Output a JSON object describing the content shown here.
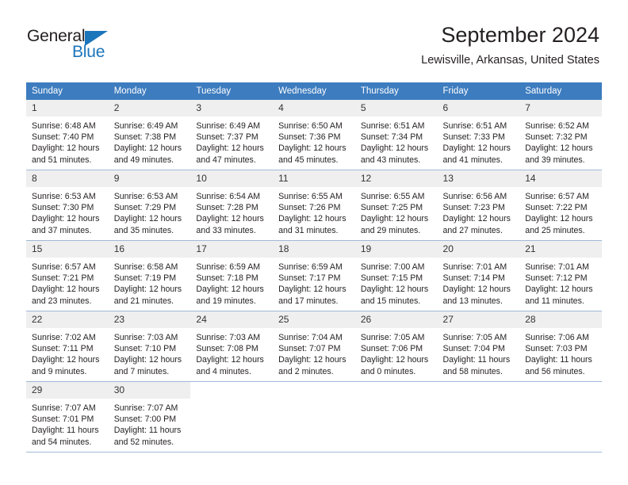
{
  "logo": {
    "word_top": "General",
    "word_bottom": "Blue",
    "triangle_color": "#1b75bb",
    "text_color": "#231f20"
  },
  "header": {
    "title": "September 2024",
    "subtitle": "Lewisville, Arkansas, United States"
  },
  "theme": {
    "header_row_bg": "#3d7cbf",
    "header_row_text": "#ffffff",
    "day_number_bg": "#efefef",
    "grid_line": "#9fb9d6",
    "body_text": "#231f20"
  },
  "calendar": {
    "weekdays": [
      "Sunday",
      "Monday",
      "Tuesday",
      "Wednesday",
      "Thursday",
      "Friday",
      "Saturday"
    ],
    "weeks": [
      [
        {
          "day": "1",
          "sunrise": "Sunrise: 6:48 AM",
          "sunset": "Sunset: 7:40 PM",
          "daylight1": "Daylight: 12 hours",
          "daylight2": "and 51 minutes."
        },
        {
          "day": "2",
          "sunrise": "Sunrise: 6:49 AM",
          "sunset": "Sunset: 7:38 PM",
          "daylight1": "Daylight: 12 hours",
          "daylight2": "and 49 minutes."
        },
        {
          "day": "3",
          "sunrise": "Sunrise: 6:49 AM",
          "sunset": "Sunset: 7:37 PM",
          "daylight1": "Daylight: 12 hours",
          "daylight2": "and 47 minutes."
        },
        {
          "day": "4",
          "sunrise": "Sunrise: 6:50 AM",
          "sunset": "Sunset: 7:36 PM",
          "daylight1": "Daylight: 12 hours",
          "daylight2": "and 45 minutes."
        },
        {
          "day": "5",
          "sunrise": "Sunrise: 6:51 AM",
          "sunset": "Sunset: 7:34 PM",
          "daylight1": "Daylight: 12 hours",
          "daylight2": "and 43 minutes."
        },
        {
          "day": "6",
          "sunrise": "Sunrise: 6:51 AM",
          "sunset": "Sunset: 7:33 PM",
          "daylight1": "Daylight: 12 hours",
          "daylight2": "and 41 minutes."
        },
        {
          "day": "7",
          "sunrise": "Sunrise: 6:52 AM",
          "sunset": "Sunset: 7:32 PM",
          "daylight1": "Daylight: 12 hours",
          "daylight2": "and 39 minutes."
        }
      ],
      [
        {
          "day": "8",
          "sunrise": "Sunrise: 6:53 AM",
          "sunset": "Sunset: 7:30 PM",
          "daylight1": "Daylight: 12 hours",
          "daylight2": "and 37 minutes."
        },
        {
          "day": "9",
          "sunrise": "Sunrise: 6:53 AM",
          "sunset": "Sunset: 7:29 PM",
          "daylight1": "Daylight: 12 hours",
          "daylight2": "and 35 minutes."
        },
        {
          "day": "10",
          "sunrise": "Sunrise: 6:54 AM",
          "sunset": "Sunset: 7:28 PM",
          "daylight1": "Daylight: 12 hours",
          "daylight2": "and 33 minutes."
        },
        {
          "day": "11",
          "sunrise": "Sunrise: 6:55 AM",
          "sunset": "Sunset: 7:26 PM",
          "daylight1": "Daylight: 12 hours",
          "daylight2": "and 31 minutes."
        },
        {
          "day": "12",
          "sunrise": "Sunrise: 6:55 AM",
          "sunset": "Sunset: 7:25 PM",
          "daylight1": "Daylight: 12 hours",
          "daylight2": "and 29 minutes."
        },
        {
          "day": "13",
          "sunrise": "Sunrise: 6:56 AM",
          "sunset": "Sunset: 7:23 PM",
          "daylight1": "Daylight: 12 hours",
          "daylight2": "and 27 minutes."
        },
        {
          "day": "14",
          "sunrise": "Sunrise: 6:57 AM",
          "sunset": "Sunset: 7:22 PM",
          "daylight1": "Daylight: 12 hours",
          "daylight2": "and 25 minutes."
        }
      ],
      [
        {
          "day": "15",
          "sunrise": "Sunrise: 6:57 AM",
          "sunset": "Sunset: 7:21 PM",
          "daylight1": "Daylight: 12 hours",
          "daylight2": "and 23 minutes."
        },
        {
          "day": "16",
          "sunrise": "Sunrise: 6:58 AM",
          "sunset": "Sunset: 7:19 PM",
          "daylight1": "Daylight: 12 hours",
          "daylight2": "and 21 minutes."
        },
        {
          "day": "17",
          "sunrise": "Sunrise: 6:59 AM",
          "sunset": "Sunset: 7:18 PM",
          "daylight1": "Daylight: 12 hours",
          "daylight2": "and 19 minutes."
        },
        {
          "day": "18",
          "sunrise": "Sunrise: 6:59 AM",
          "sunset": "Sunset: 7:17 PM",
          "daylight1": "Daylight: 12 hours",
          "daylight2": "and 17 minutes."
        },
        {
          "day": "19",
          "sunrise": "Sunrise: 7:00 AM",
          "sunset": "Sunset: 7:15 PM",
          "daylight1": "Daylight: 12 hours",
          "daylight2": "and 15 minutes."
        },
        {
          "day": "20",
          "sunrise": "Sunrise: 7:01 AM",
          "sunset": "Sunset: 7:14 PM",
          "daylight1": "Daylight: 12 hours",
          "daylight2": "and 13 minutes."
        },
        {
          "day": "21",
          "sunrise": "Sunrise: 7:01 AM",
          "sunset": "Sunset: 7:12 PM",
          "daylight1": "Daylight: 12 hours",
          "daylight2": "and 11 minutes."
        }
      ],
      [
        {
          "day": "22",
          "sunrise": "Sunrise: 7:02 AM",
          "sunset": "Sunset: 7:11 PM",
          "daylight1": "Daylight: 12 hours",
          "daylight2": "and 9 minutes."
        },
        {
          "day": "23",
          "sunrise": "Sunrise: 7:03 AM",
          "sunset": "Sunset: 7:10 PM",
          "daylight1": "Daylight: 12 hours",
          "daylight2": "and 7 minutes."
        },
        {
          "day": "24",
          "sunrise": "Sunrise: 7:03 AM",
          "sunset": "Sunset: 7:08 PM",
          "daylight1": "Daylight: 12 hours",
          "daylight2": "and 4 minutes."
        },
        {
          "day": "25",
          "sunrise": "Sunrise: 7:04 AM",
          "sunset": "Sunset: 7:07 PM",
          "daylight1": "Daylight: 12 hours",
          "daylight2": "and 2 minutes."
        },
        {
          "day": "26",
          "sunrise": "Sunrise: 7:05 AM",
          "sunset": "Sunset: 7:06 PM",
          "daylight1": "Daylight: 12 hours",
          "daylight2": "and 0 minutes."
        },
        {
          "day": "27",
          "sunrise": "Sunrise: 7:05 AM",
          "sunset": "Sunset: 7:04 PM",
          "daylight1": "Daylight: 11 hours",
          "daylight2": "and 58 minutes."
        },
        {
          "day": "28",
          "sunrise": "Sunrise: 7:06 AM",
          "sunset": "Sunset: 7:03 PM",
          "daylight1": "Daylight: 11 hours",
          "daylight2": "and 56 minutes."
        }
      ],
      [
        {
          "day": "29",
          "sunrise": "Sunrise: 7:07 AM",
          "sunset": "Sunset: 7:01 PM",
          "daylight1": "Daylight: 11 hours",
          "daylight2": "and 54 minutes."
        },
        {
          "day": "30",
          "sunrise": "Sunrise: 7:07 AM",
          "sunset": "Sunset: 7:00 PM",
          "daylight1": "Daylight: 11 hours",
          "daylight2": "and 52 minutes."
        },
        {
          "day": "",
          "sunrise": "",
          "sunset": "",
          "daylight1": "",
          "daylight2": ""
        },
        {
          "day": "",
          "sunrise": "",
          "sunset": "",
          "daylight1": "",
          "daylight2": ""
        },
        {
          "day": "",
          "sunrise": "",
          "sunset": "",
          "daylight1": "",
          "daylight2": ""
        },
        {
          "day": "",
          "sunrise": "",
          "sunset": "",
          "daylight1": "",
          "daylight2": ""
        },
        {
          "day": "",
          "sunrise": "",
          "sunset": "",
          "daylight1": "",
          "daylight2": ""
        }
      ]
    ]
  }
}
